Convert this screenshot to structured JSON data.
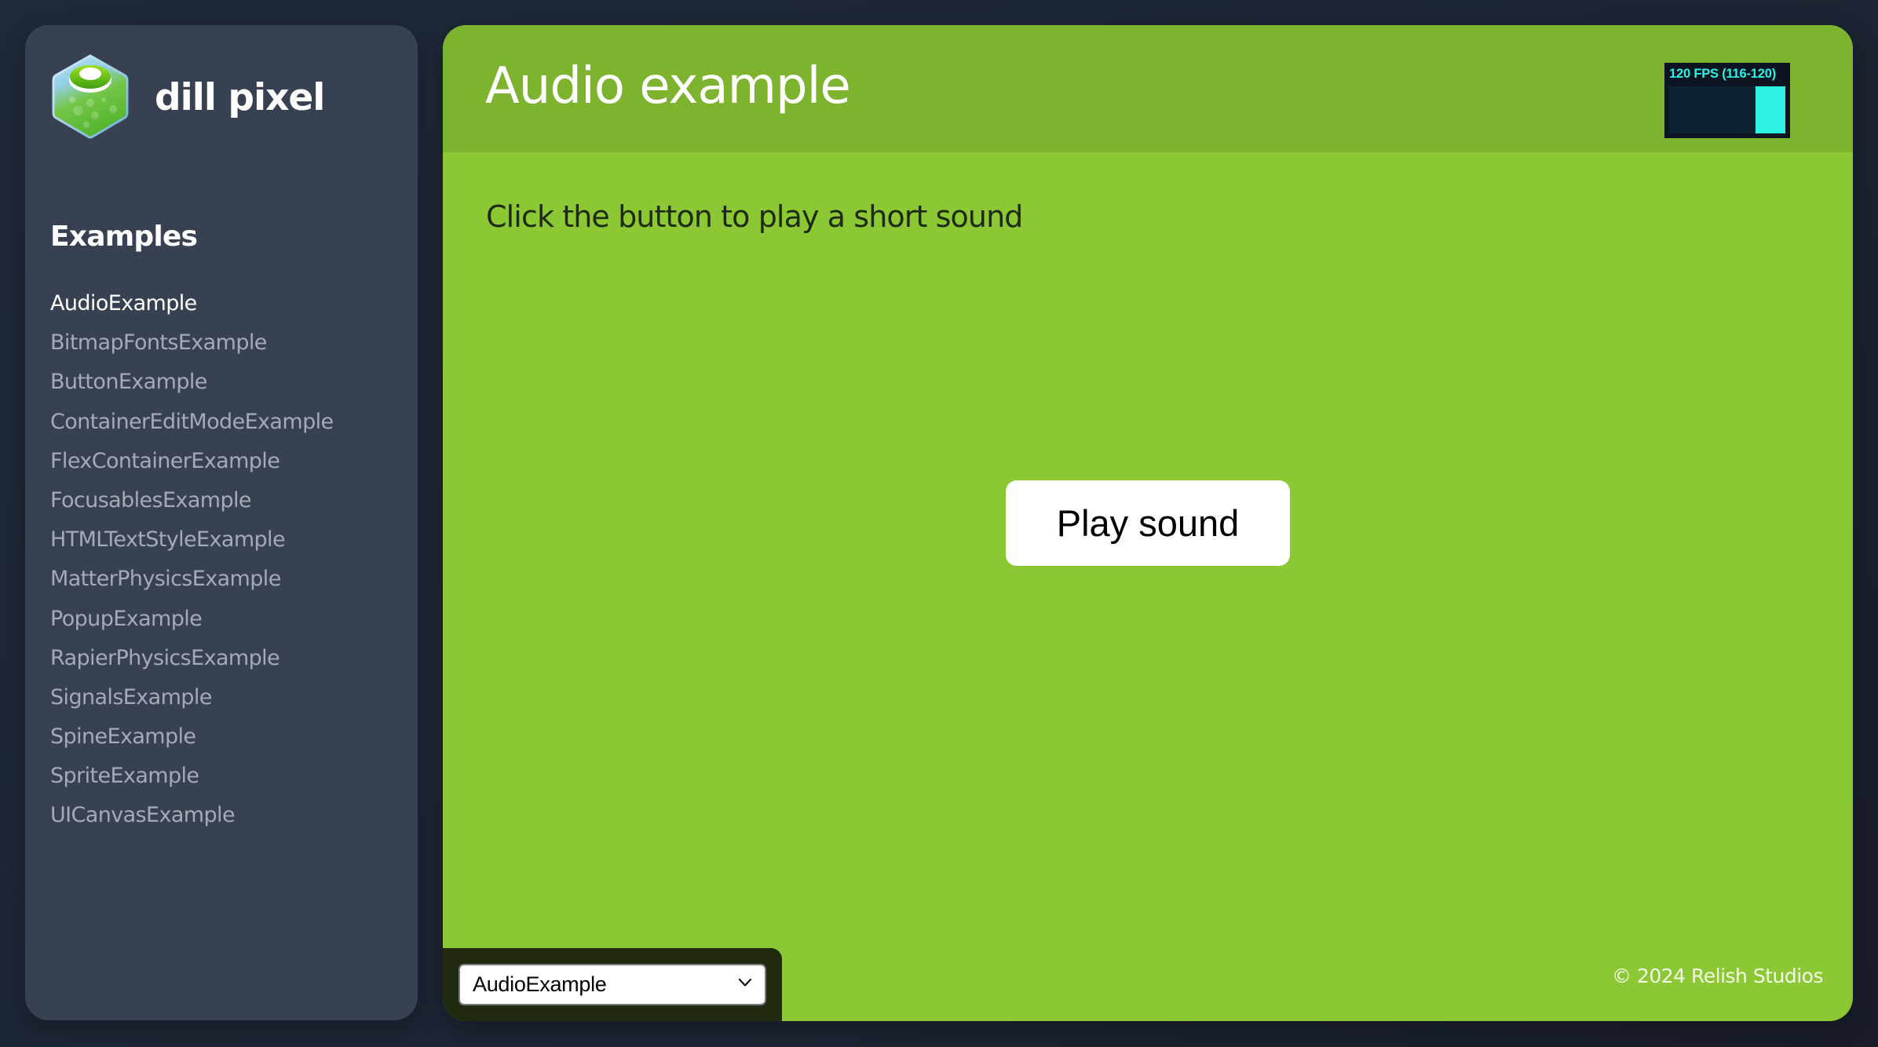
{
  "sidebar": {
    "brand_name": "dill pixel",
    "logo_icon": "dill-jar-hexagon-logo",
    "section_heading": "Examples",
    "active_item": "AudioExample",
    "items": [
      {
        "label": "AudioExample",
        "active": true
      },
      {
        "label": "BitmapFontsExample",
        "active": false
      },
      {
        "label": "ButtonExample",
        "active": false
      },
      {
        "label": "ContainerEditModeExample",
        "active": false
      },
      {
        "label": "FlexContainerExample",
        "active": false
      },
      {
        "label": "FocusablesExample",
        "active": false
      },
      {
        "label": "HTMLTextStyleExample",
        "active": false
      },
      {
        "label": "MatterPhysicsExample",
        "active": false
      },
      {
        "label": "PopupExample",
        "active": false
      },
      {
        "label": "RapierPhysicsExample",
        "active": false
      },
      {
        "label": "SignalsExample",
        "active": false
      },
      {
        "label": "SpineExample",
        "active": false
      },
      {
        "label": "SpriteExample",
        "active": false
      },
      {
        "label": "UICanvasExample",
        "active": false
      }
    ]
  },
  "main": {
    "title": "Audio example",
    "instructions": "Click the button to play a short sound",
    "play_button_label": "Play sound",
    "copyright": "© 2024 Relish Studios"
  },
  "fps_meter": {
    "label": "120 FPS (116-120)",
    "current_fps": 120,
    "min_fps": 116,
    "max_fps": 120,
    "bar_fill_fraction": 1.0
  },
  "example_selector": {
    "selected_value": "AudioExample",
    "icon": "chevron-down-icon"
  },
  "colors": {
    "page_background": "#1f2937",
    "sidebar_background": "#374151",
    "header_green": "#7db32f",
    "body_green": "#8bc834",
    "fps_accent": "#2ef2e6",
    "selector_background": "#1f2a10"
  }
}
